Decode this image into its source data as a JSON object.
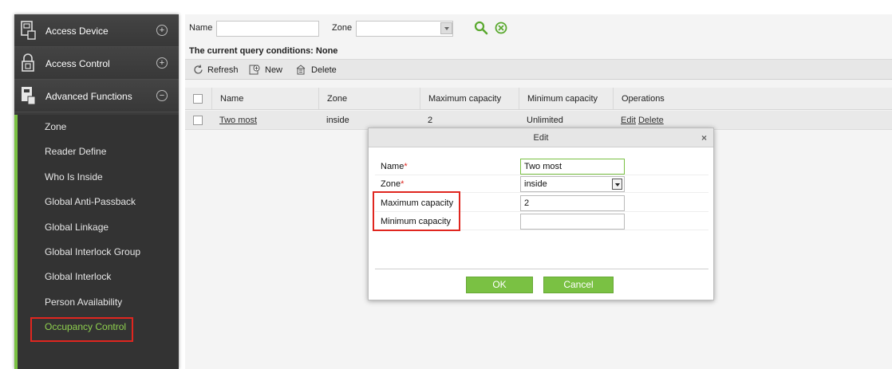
{
  "sidebar": {
    "groups": [
      {
        "label": "Access Device",
        "toggle": "+",
        "icon": "device-icon"
      },
      {
        "label": "Access Control",
        "toggle": "+",
        "icon": "lock-icon"
      },
      {
        "label": "Advanced Functions",
        "toggle": "−",
        "icon": "advanced-functions-icon"
      }
    ],
    "items": [
      "Zone",
      "Reader Define",
      "Who Is Inside",
      "Global Anti-Passback",
      "Global Linkage",
      "Global Interlock Group",
      "Global Interlock",
      "Person Availability",
      "Occupancy Control"
    ],
    "active_item": "Occupancy Control"
  },
  "query": {
    "name_label": "Name",
    "name_value": "",
    "zone_label": "Zone",
    "zone_value": "",
    "conditions_text": "The current query conditions:",
    "conditions_value": "None"
  },
  "toolbar": {
    "refresh": "Refresh",
    "new": "New",
    "delete": "Delete"
  },
  "table": {
    "columns": [
      "Name",
      "Zone",
      "Maximum capacity",
      "Minimum capacity",
      "Operations"
    ],
    "rows": [
      {
        "name": "Two most",
        "zone": "inside",
        "max": "2",
        "min": "Unlimited",
        "op_edit": "Edit",
        "op_delete": "Delete"
      }
    ]
  },
  "dialog": {
    "title": "Edit",
    "close": "×",
    "fields": {
      "name_label": "Name",
      "name_value": "Two most",
      "zone_label": "Zone",
      "zone_value": "inside",
      "max_label": "Maximum capacity",
      "max_value": "2",
      "min_label": "Minimum capacity",
      "min_value": ""
    },
    "required_mark": "*",
    "ok": "OK",
    "cancel": "Cancel"
  },
  "colors": {
    "accent": "#7ac143",
    "highlight": "#e0261f",
    "sidebar_bg": "#3b3b3b"
  }
}
